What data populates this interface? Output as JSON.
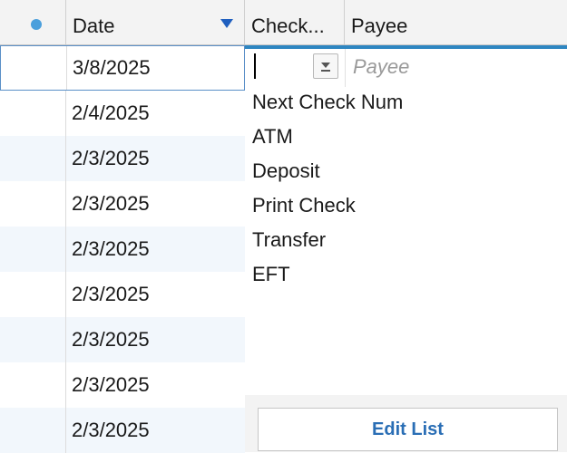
{
  "colors": {
    "accent": "#2e86c1",
    "status_dot": "#4a9fdc",
    "sort_arrow": "#1f5fbf",
    "alt_row": "#f2f7fc",
    "edit_list_text": "#2a6eb5"
  },
  "header": {
    "columns": [
      {
        "key": "status",
        "label": "",
        "icon": "dot-icon"
      },
      {
        "key": "date",
        "label": "Date",
        "sort": "descending"
      },
      {
        "key": "check",
        "label": "Check..."
      },
      {
        "key": "payee",
        "label": "Payee"
      }
    ]
  },
  "rows": [
    {
      "date": "3/8/2025",
      "selected": true
    },
    {
      "date": "2/4/2025"
    },
    {
      "date": "2/3/2025"
    },
    {
      "date": "2/3/2025"
    },
    {
      "date": "2/3/2025"
    },
    {
      "date": "2/3/2025"
    },
    {
      "date": "2/3/2025"
    },
    {
      "date": "2/3/2025"
    },
    {
      "date": "2/3/2025"
    }
  ],
  "edit_row": {
    "check_value": "",
    "payee_placeholder": "Payee",
    "dropdown_icon": "dropdown-arrow-icon"
  },
  "dropdown": {
    "options": [
      "Next Check Num",
      "ATM",
      "Deposit",
      "Print Check",
      "Transfer",
      "EFT"
    ],
    "edit_list_label": "Edit List"
  }
}
